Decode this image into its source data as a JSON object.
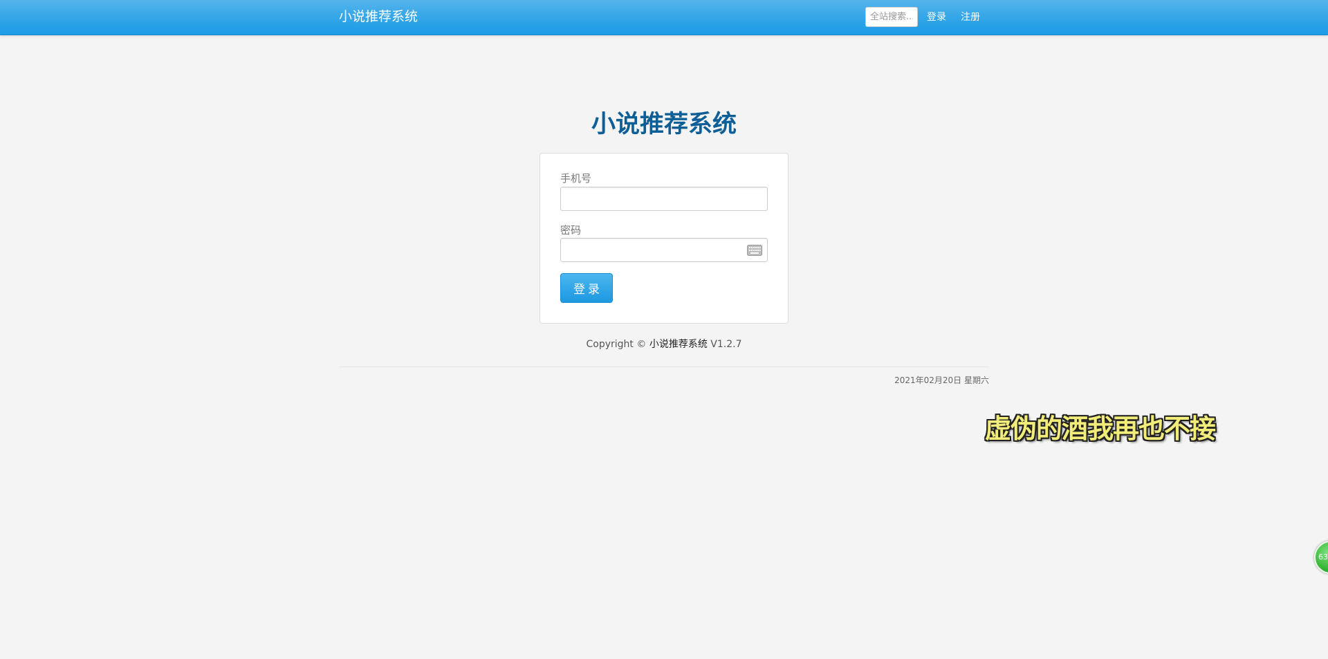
{
  "navbar": {
    "brand": "小说推荐系统",
    "search_placeholder": "全站搜索...",
    "login_label": "登录",
    "register_label": "注册",
    "colors": {
      "bar": "#2fa4e7",
      "text": "#ffffff"
    }
  },
  "main": {
    "title": "小说推荐系统",
    "title_color": "#0f5f97",
    "form": {
      "phone_label": "手机号",
      "phone_value": "",
      "password_label": "密码",
      "password_value": "",
      "keyboard_icon": "keyboard-icon",
      "submit_label": "登录"
    }
  },
  "footer": {
    "copyright_prefix": "Copyright ©",
    "copyright_brand": "小说推荐系统",
    "version": "V1.2.7",
    "date": "2021年02月20日 星期六"
  },
  "overlay": {
    "caption": "虚伪的酒我再也不接",
    "badge_text": "63"
  }
}
